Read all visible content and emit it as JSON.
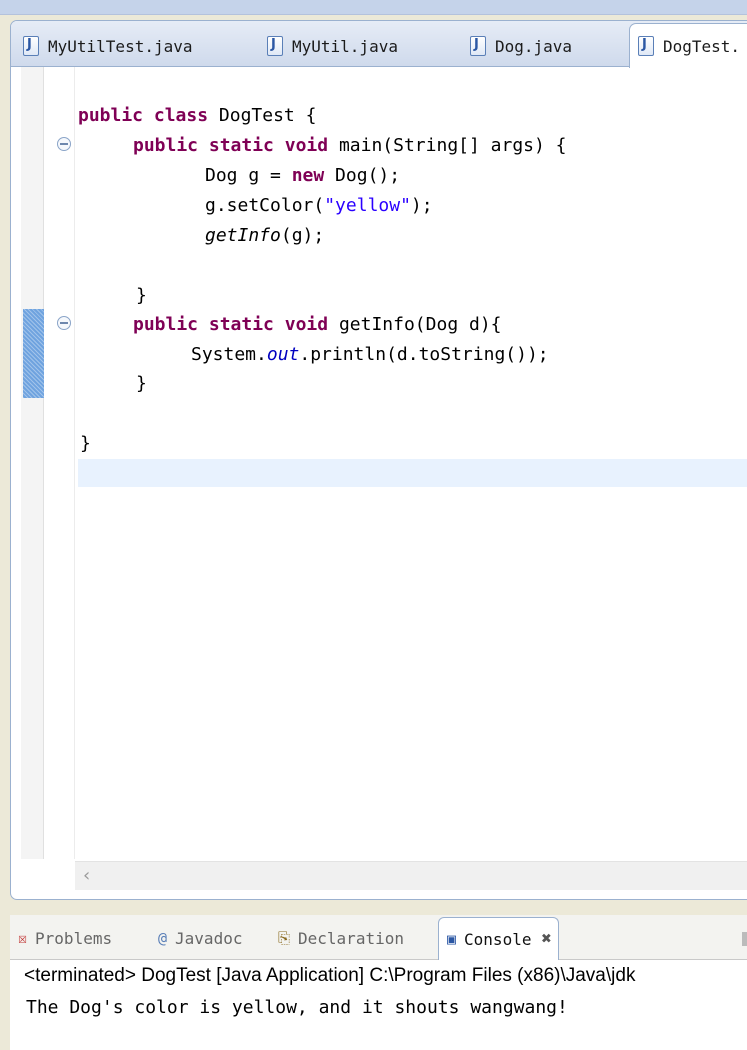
{
  "editor_tabs": [
    {
      "label": "MyUtilTest.java",
      "icon": "java-file-icon",
      "active": false
    },
    {
      "label": "MyUtil.java",
      "icon": "java-file-icon",
      "active": false
    },
    {
      "label": "Dog.java",
      "icon": "java-file-icon",
      "active": false
    },
    {
      "label": "DogTest.",
      "icon": "java-file-icon",
      "active": true
    }
  ],
  "code": {
    "l1": {
      "kw1": "public",
      "kw2": "class",
      "rest": " DogTest {"
    },
    "l2": {
      "kw1": "public",
      "kw2": "static",
      "kw3": "void",
      "rest": " main(String[] args) {"
    },
    "l3": {
      "pre": "Dog g = ",
      "kw": "new",
      "rest": " Dog();"
    },
    "l4": {
      "pre": "g.setColor(",
      "str": "\"yellow\"",
      "rest": ");"
    },
    "l5": {
      "it": "getInfo",
      "rest": "(g);"
    },
    "l6": "}",
    "l7": {
      "kw1": "public",
      "kw2": "static",
      "kw3": "void",
      "rest": " getInfo(Dog d){"
    },
    "l8": {
      "pre": "System.",
      "fld": "out",
      "rest": ".println(d.toString());"
    },
    "l9": "}",
    "l10": "}"
  },
  "console_tabs": [
    {
      "label": "Problems",
      "icon": "problems-icon",
      "active": false
    },
    {
      "label": "Javadoc",
      "icon": "javadoc-icon",
      "active": false
    },
    {
      "label": "Declaration",
      "icon": "declaration-icon",
      "active": false
    },
    {
      "label": "Console",
      "icon": "console-icon",
      "active": true,
      "close": "✖"
    }
  ],
  "console": {
    "status": "<terminated> DogTest [Java Application] C:\\Program Files (x86)\\Java\\jdk",
    "output": "The Dog's color is yellow, and it shouts wangwang!"
  },
  "colors": {
    "keyword": "#7f0055",
    "string": "#2a00ff",
    "field": "#0000c0",
    "current_line": "#e8f2fe",
    "change_marker": "#6fa3df"
  }
}
